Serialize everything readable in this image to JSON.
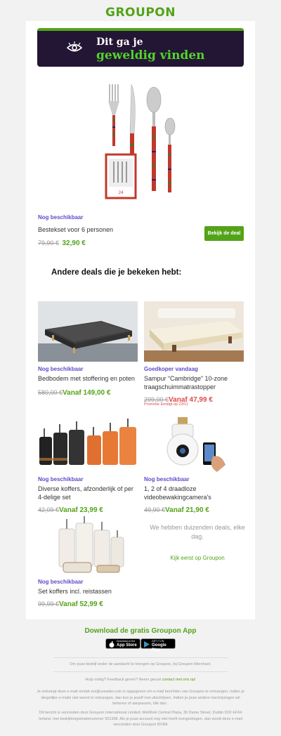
{
  "header": {
    "logo": "GROUPON"
  },
  "banner": {
    "line1": "Dit ga je",
    "line2": "geweldig vinden"
  },
  "hero": {
    "status": "Nog beschikbaar",
    "title": "Bestekset voor 6 personen",
    "old_price": "79,90 €",
    "new_price": "32,90 €",
    "button": "Bekijk de deal",
    "box_label": "24"
  },
  "section": {
    "title": "Andere deals die je bekeken hebt:"
  },
  "deals": [
    {
      "status": "Nog beschikbaar",
      "title": "Bedbodem met stoffering en poten",
      "old_price": "580,00 €",
      "new_price": "Vanaf 149,00 €"
    },
    {
      "status": "Goedkoper vandaag",
      "title": "Sampur “Cambridge” 10-zone traagschuimmatrastopper",
      "old_price": "299,00 €",
      "new_price": "Vanaf 47,99 €",
      "promo": "Promotie Eindigt op 23/11"
    },
    {
      "status": "Nog beschikbaar",
      "title": "Diverse koffers, afzonderlijk of per 4-delige set",
      "old_price": "42,09 €",
      "new_price": "Vanaf 23,99 €"
    },
    {
      "status": "Nog beschikbaar",
      "title": "1, 2 of 4 draadloze videobewakingcamera's",
      "old_price": "49,90 €",
      "new_price": "Vanaf 21,90 €"
    },
    {
      "status": "Nog beschikbaar",
      "title": "Set koffers incl. reistassen",
      "old_price": "99,99 €",
      "new_price": "Vanaf 52,99 €"
    }
  ],
  "side": {
    "message": "We hebben duizenden deals, elke dag.",
    "link": "Kijk eerst op Groupon"
  },
  "app": {
    "title": "Download de gratis Groupon App",
    "appstore_small": "Download on the",
    "appstore_big": "App Store",
    "googleplay_small": "GET IT ON",
    "googleplay_big": "Google Play"
  },
  "footer": {
    "merchant": "Om jouw bedrijf onder de aandacht te brengen op Groupon, bij Groupon Merchant.",
    "help_text": "Hulp nodig? Feedback geven? Neem gerust",
    "help_link": "contact met ons op!",
    "subscription": "Je ontvangt deze e-mail omdat xxx@ureader.com is opgegeven om e-mail berichten van Groupon te ontvangen. Indien je dergelijke e-mails niet wenst te ontvangen, dan kun je jezelf met uitschrijven. Indien je jouw andere inschrijvingen wil beheren of aanpassen, klik dan .",
    "legal": "Dit bericht is verzonden door Groupon International Limited, WeWork Central Plaza, 36 Dame Street, Dublin D02 EF64 Ierland, met bedrijfsregistratienummer 501358. Als je jouw account nog niet heeft overgedragen, dan wordt deze e-mail verzonden door Groupon BVBA"
  },
  "colors": {
    "brand_green": "#53a318",
    "banner_bg": "#231634",
    "status_purple": "#5b4ec8",
    "promo_red": "#e04b4b"
  }
}
